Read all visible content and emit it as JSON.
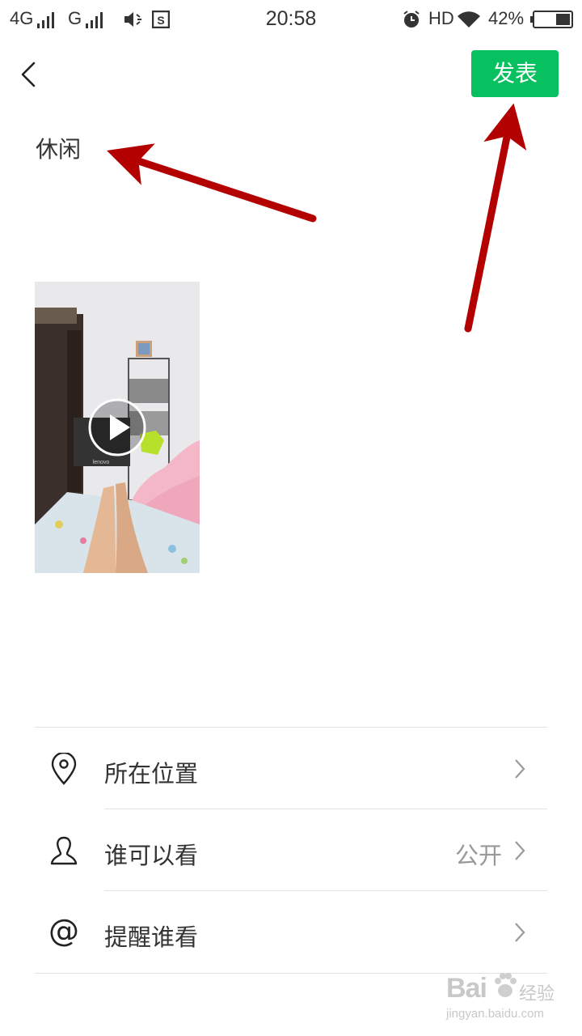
{
  "status_bar": {
    "network_1": "4G",
    "network_2": "G",
    "time": "20:58",
    "hd": "HD",
    "battery": "42%"
  },
  "header": {
    "publish_label": "发表"
  },
  "post": {
    "text": "休闲"
  },
  "options": [
    {
      "label": "所在位置",
      "value": "",
      "icon": "location-pin-icon"
    },
    {
      "label": "谁可以看",
      "value": "公开",
      "icon": "person-icon"
    },
    {
      "label": "提醒谁看",
      "value": "",
      "icon": "at-icon"
    }
  ],
  "watermark": {
    "brand": "Bai",
    "brand_suffix": "经验",
    "url": "jingyan.baidu.com"
  },
  "colors": {
    "accent": "#07c160",
    "annotation_arrow": "#b30000"
  }
}
